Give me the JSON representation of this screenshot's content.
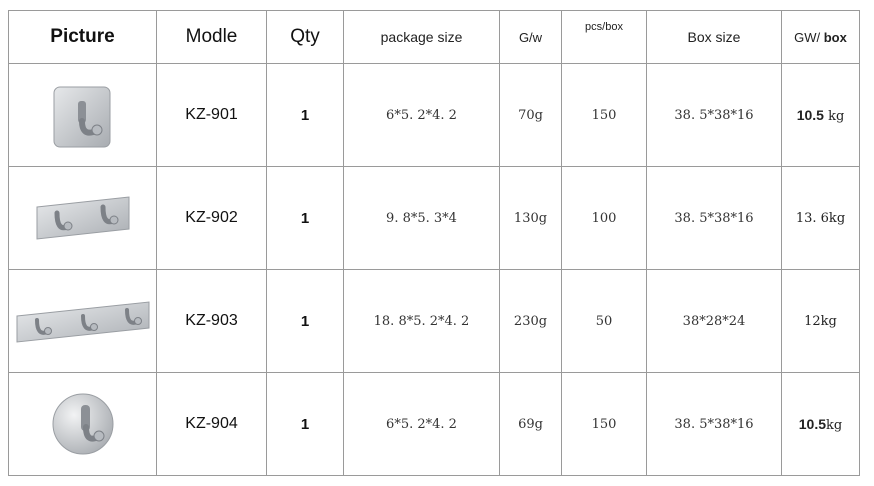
{
  "headers": [
    "Picture",
    "Modle",
    "Qty",
    "package size",
    "G/w",
    "pcs/box",
    "Box size",
    "GW/ box"
  ],
  "rows": [
    {
      "model": "KZ-901",
      "qty": "1",
      "package_size": "6*5. 2*4. 2",
      "gw": "70g",
      "pcs_box": "150",
      "box_size": "38. 5*38*16",
      "gw_box": "10.5 kg",
      "image": "single-square-hook"
    },
    {
      "model": "KZ-902",
      "qty": "1",
      "package_size": "9. 8*5. 3*4",
      "gw": "130g",
      "pcs_box": "100",
      "box_size": "38. 5*38*16",
      "gw_box": "13. 6kg",
      "image": "double-hook-rail"
    },
    {
      "model": "KZ-903",
      "qty": "1",
      "package_size": "18. 8*5. 2*4. 2",
      "gw": "230g",
      "pcs_box": "50",
      "box_size": "38*28*24",
      "gw_box": "12kg",
      "image": "triple-hook-rail"
    },
    {
      "model": "KZ-904",
      "qty": "1",
      "package_size": "6*5. 2*4. 2",
      "gw": "69g",
      "pcs_box": "150",
      "box_size": "38. 5*38*16",
      "gw_box": "10.5kg",
      "image": "single-round-hook"
    }
  ],
  "colors": {
    "border": "#9a9a9a",
    "metal": "#c9ccd0",
    "metal_dark": "#8c9096"
  }
}
